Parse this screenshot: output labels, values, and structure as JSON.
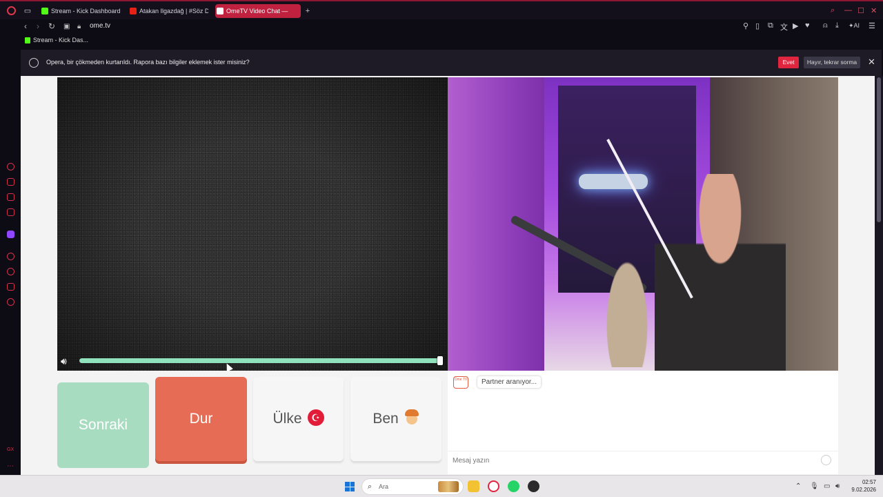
{
  "browser": {
    "tabs": [
      {
        "label": "Stream - Kick Dashboard",
        "active": false
      },
      {
        "label": "Atakan Ilgazdağ | #Söz D",
        "active": false
      },
      {
        "label": "OmeTV Video Chat —",
        "active": true
      }
    ],
    "url": "ome.tv",
    "bookmark": "Stream - Kick Das...",
    "infobar": {
      "message": "Opera, bir çökmeden kurtarıldı. Rapora bazı bilgiler eklemek ister misiniz?",
      "yes": "Evet",
      "no": "Hayır, tekrar sorma"
    }
  },
  "ometv": {
    "volume_level": 1.0,
    "buttons": {
      "next": "Sonraki",
      "stop": "Dur",
      "country": "Ülke",
      "me": "Ben"
    },
    "status_message": "Partner aranıyor...",
    "message_placeholder": "Mesaj yazın",
    "logo_text": "Ome TV"
  },
  "taskbar": {
    "search_placeholder": "Ara",
    "time": "02:57",
    "date": "9.02.2026"
  },
  "colors": {
    "accent": "#e0253e",
    "next_button": "#a8dcc1",
    "stop_button": "#e76c55"
  }
}
